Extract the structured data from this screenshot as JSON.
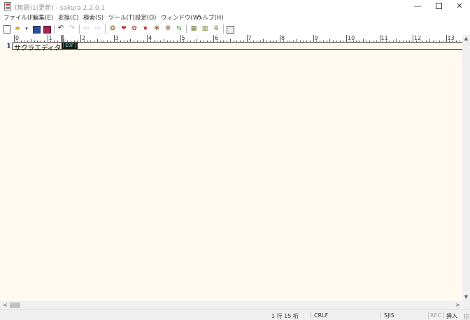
{
  "window": {
    "title": "(無題)1(更新) - sakura 2.2.0.1",
    "minimize_glyph": "—",
    "close_glyph": "✕"
  },
  "menu": [
    "ファイル(F)",
    "編集(E)",
    "変換(C)",
    "検索(S)",
    "ツール(T)",
    "設定(O)",
    "ウィンドウ(W)",
    "ヘルプ(H)"
  ],
  "toolbar": {
    "icons": [
      "new-file-icon",
      "open-file-icon",
      "dropdown-icon",
      "save-icon",
      "save-as-icon",
      "undo-icon",
      "redo-icon",
      "back-icon",
      "forward-icon",
      "search-icon",
      "find-next-icon",
      "find-prev-icon",
      "replace-icon",
      "bookmark-search-icon",
      "tag-jump-icon",
      "grep-icon",
      "grep-replace-icon",
      "compare-icon",
      "view-mode-icon"
    ]
  },
  "ruler": {
    "numbers": [
      "0",
      "1",
      "2",
      "3",
      "4",
      "5",
      "6",
      "7",
      "8",
      "9",
      "10",
      "11",
      "12",
      "13"
    ]
  },
  "editor": {
    "line_number": "1",
    "text": "サクラエディタ",
    "eof_marker": "[EOF]",
    "background": "#fff9ef"
  },
  "scrollbar": {
    "left_arrow": "<",
    "right_arrow": ">",
    "up_arrow": "▲",
    "down_arrow": "▼"
  },
  "status": {
    "position": "1 行  15 桁",
    "line_ending": "CRLF",
    "encoding": "SJIS",
    "rec": "REC",
    "insert_mode": "挿入"
  }
}
